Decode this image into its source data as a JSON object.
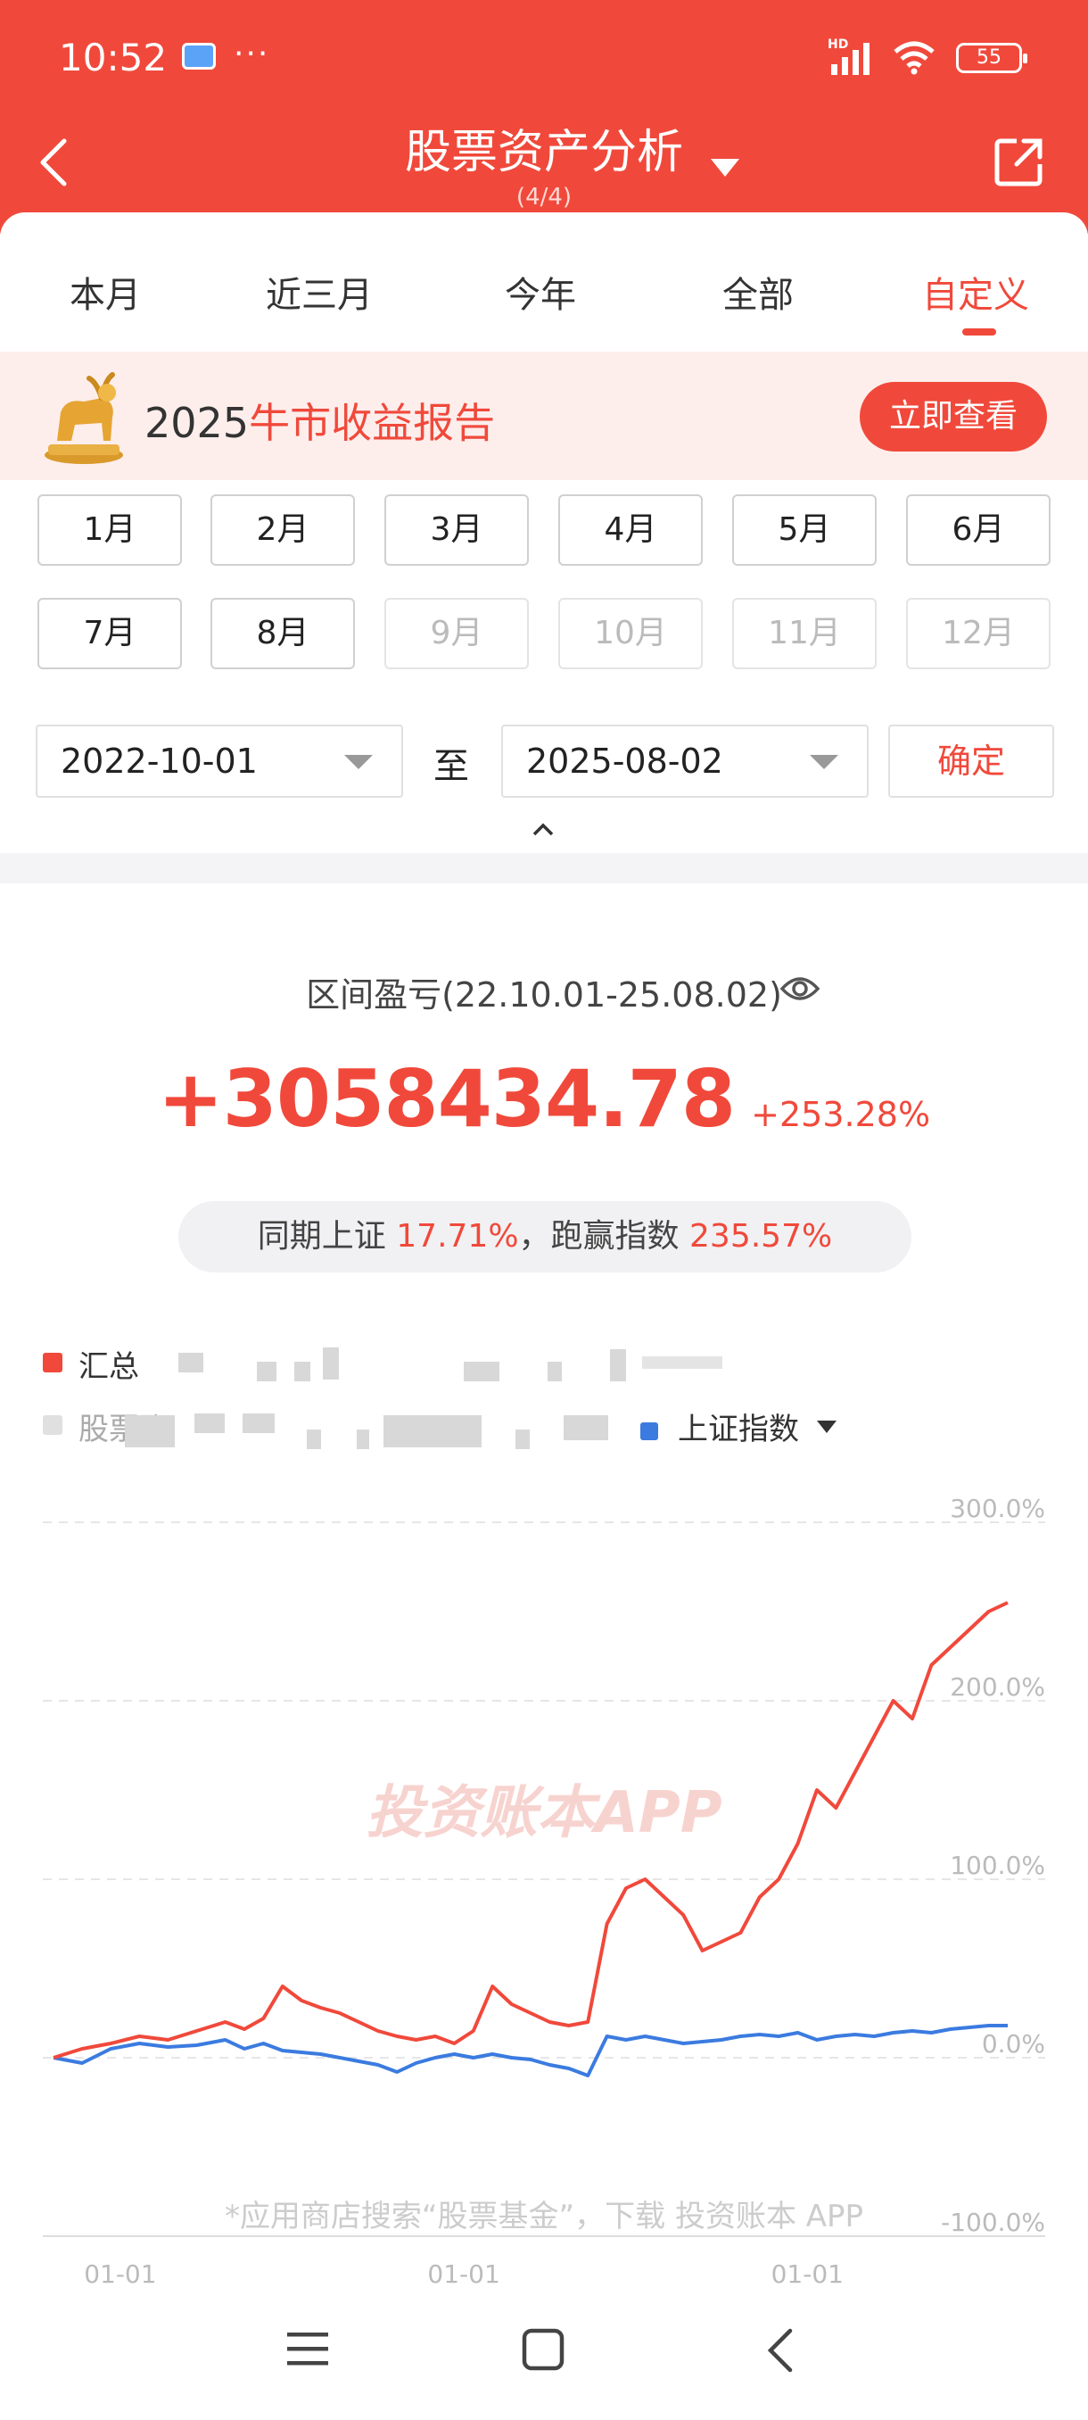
{
  "status_bar": {
    "time": "10:52",
    "dots": "···",
    "network": "HD",
    "battery": "55"
  },
  "header": {
    "title": "股票资产分析",
    "subtitle": "(4/4)"
  },
  "tabs": [
    {
      "label": "本月"
    },
    {
      "label": "近三月"
    },
    {
      "label": "今年"
    },
    {
      "label": "全部"
    },
    {
      "label": "自定义",
      "active": true
    }
  ],
  "banner": {
    "year": "2025",
    "title": "牛市收益报告",
    "button": "立即查看"
  },
  "months": [
    {
      "label": "1月",
      "enabled": true
    },
    {
      "label": "2月",
      "enabled": true
    },
    {
      "label": "3月",
      "enabled": true
    },
    {
      "label": "4月",
      "enabled": true
    },
    {
      "label": "5月",
      "enabled": true
    },
    {
      "label": "6月",
      "enabled": true
    },
    {
      "label": "7月",
      "enabled": true
    },
    {
      "label": "8月",
      "enabled": true
    },
    {
      "label": "9月",
      "enabled": false
    },
    {
      "label": "10月",
      "enabled": false
    },
    {
      "label": "11月",
      "enabled": false
    },
    {
      "label": "12月",
      "enabled": false
    }
  ],
  "date_range": {
    "start": "2022-10-01",
    "to_label": "至",
    "end": "2025-08-02",
    "confirm": "确定"
  },
  "summary": {
    "range_label": "区间盈亏(22.10.01-25.08.02)",
    "pnl": "+3058434.78",
    "pnl_pct": "+253.28%",
    "index_prefix": "同期上证",
    "index_pct": "17.71%",
    "beat_prefix": "，跑赢指数",
    "beat_pct": "235.57%"
  },
  "legend": {
    "total": "汇总",
    "stock_account": "股票账",
    "index": "上证指数"
  },
  "colors": {
    "accent": "#f0493b",
    "index_line": "#3b7be0"
  },
  "watermark": "投资账本APP",
  "footer_note": "*应用商店搜索“股票基金”，下载 投资账本 APP",
  "chart_data": {
    "type": "line",
    "y_ticks": [
      "300.0%",
      "200.0%",
      "100.0%",
      "0.0%",
      "-100.0%"
    ],
    "x_ticks": [
      "01-01",
      "01-01",
      "01-01"
    ],
    "ylim": [
      -100,
      300
    ],
    "series": [
      {
        "name": "汇总",
        "color": "#f0493b",
        "x": [
          0,
          0.03,
          0.06,
          0.09,
          0.12,
          0.15,
          0.18,
          0.2,
          0.22,
          0.24,
          0.26,
          0.28,
          0.3,
          0.32,
          0.34,
          0.36,
          0.38,
          0.4,
          0.42,
          0.44,
          0.46,
          0.48,
          0.5,
          0.52,
          0.54,
          0.56,
          0.58,
          0.6,
          0.62,
          0.64,
          0.66,
          0.68,
          0.7,
          0.72,
          0.74,
          0.76,
          0.78,
          0.8,
          0.82,
          0.84,
          0.86,
          0.88,
          0.9,
          0.92,
          0.94,
          0.96,
          0.98,
          1.0
        ],
        "values": [
          0,
          5,
          8,
          12,
          10,
          15,
          20,
          16,
          22,
          40,
          32,
          28,
          25,
          20,
          15,
          12,
          10,
          12,
          8,
          15,
          40,
          30,
          25,
          20,
          18,
          20,
          75,
          95,
          100,
          90,
          80,
          60,
          65,
          70,
          90,
          100,
          120,
          150,
          140,
          160,
          180,
          200,
          190,
          220,
          230,
          240,
          250,
          255
        ]
      },
      {
        "name": "上证指数",
        "color": "#3b7be0",
        "x": [
          0,
          0.03,
          0.06,
          0.09,
          0.12,
          0.15,
          0.18,
          0.2,
          0.22,
          0.24,
          0.26,
          0.28,
          0.3,
          0.32,
          0.34,
          0.36,
          0.38,
          0.4,
          0.42,
          0.44,
          0.46,
          0.48,
          0.5,
          0.52,
          0.54,
          0.56,
          0.58,
          0.6,
          0.62,
          0.64,
          0.66,
          0.68,
          0.7,
          0.72,
          0.74,
          0.76,
          0.78,
          0.8,
          0.82,
          0.84,
          0.86,
          0.88,
          0.9,
          0.92,
          0.94,
          0.96,
          0.98,
          1.0
        ],
        "values": [
          0,
          -3,
          5,
          8,
          6,
          7,
          10,
          5,
          8,
          4,
          3,
          2,
          0,
          -2,
          -4,
          -8,
          -3,
          0,
          2,
          0,
          2,
          0,
          -1,
          -4,
          -6,
          -10,
          12,
          10,
          12,
          10,
          8,
          9,
          10,
          12,
          13,
          12,
          14,
          10,
          12,
          13,
          12,
          14,
          15,
          14,
          16,
          17,
          18,
          18
        ]
      }
    ]
  }
}
